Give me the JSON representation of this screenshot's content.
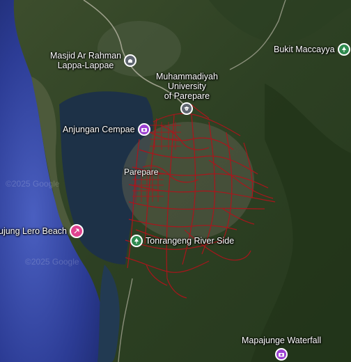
{
  "map": {
    "city_label": "Parepare",
    "watermark": "©2025 Google",
    "colors": {
      "sea": "#2b3a8a",
      "bay": "#1e3348",
      "land": "#3a4a2c",
      "forest": "#24351d",
      "route": "#b0131b",
      "pin_purple": "#9b3fd1",
      "pin_pink": "#e0428f",
      "pin_grey": "#5f6670",
      "pin_green": "#2f8a4f"
    },
    "pois": [
      {
        "label_lines": [
          "Masjid Ar Rahman",
          "Lappa-Lappae"
        ],
        "icon": "mosque-icon",
        "color": "#5f6670"
      },
      {
        "label_lines": [
          "Muhammadiyah",
          "University",
          "of Parepare"
        ],
        "icon": "school-icon",
        "color": "#5f6670"
      },
      {
        "label_lines": [
          "Bukit Maccayya"
        ],
        "icon": "park-icon",
        "color": "#2f8a4f"
      },
      {
        "label_lines": [
          "Anjungan Cempae"
        ],
        "icon": "camera-icon",
        "color": "#9b3fd1"
      },
      {
        "label_lines": [
          "ujung Lero Beach"
        ],
        "icon": "beach-icon",
        "color": "#e0428f"
      },
      {
        "label_lines": [
          "Tonrangeng River Side"
        ],
        "icon": "park-icon",
        "color": "#2f8a4f"
      },
      {
        "label_lines": [
          "Mapajunge Waterfall"
        ],
        "icon": "camera-icon",
        "color": "#9b3fd1"
      }
    ]
  }
}
